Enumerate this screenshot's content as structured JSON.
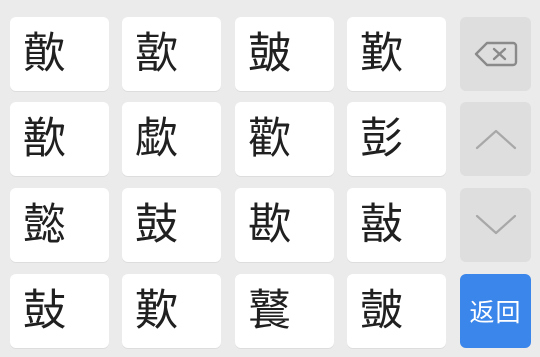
{
  "candidates": [
    [
      "歕",
      "歖",
      "皷",
      "歏"
    ],
    [
      "歚",
      "歔",
      "歡",
      "彭"
    ],
    [
      "懿",
      "鼓",
      "歁",
      "敼"
    ],
    [
      "鼔",
      "歎",
      "鼚",
      "皼"
    ]
  ],
  "side_keys": {
    "delete_icon": "backspace-icon",
    "up_icon": "chevron-up-icon",
    "down_icon": "chevron-down-icon",
    "return_label": "返回"
  },
  "colors": {
    "background": "#ebebeb",
    "key": "#ffffff",
    "side_key": "#dedede",
    "return_key": "#3b86ea",
    "icon": "#8a8a8a"
  }
}
